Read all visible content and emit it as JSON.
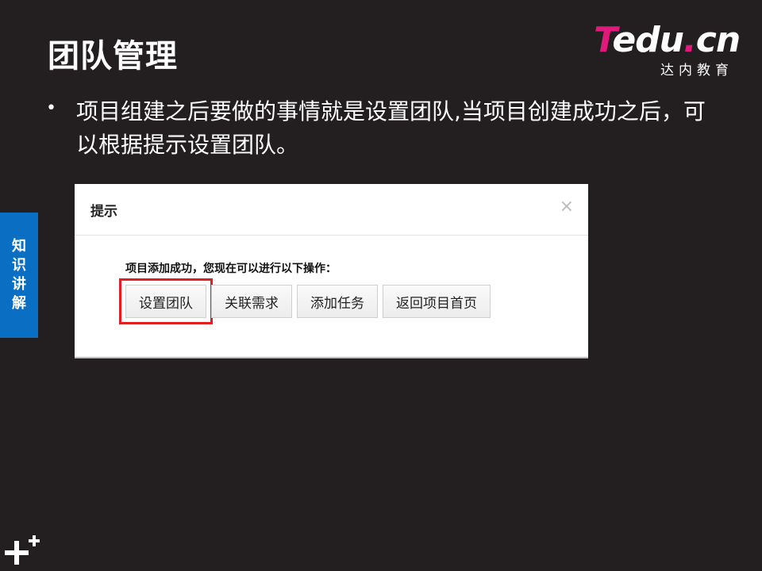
{
  "slide": {
    "title": "团队管理",
    "bullet": "项目组建之后要做的事情就是设置团队,当项目创建成功之后，可以根据提示设置团队。",
    "side_tab": [
      "知",
      "识",
      "讲",
      "解"
    ]
  },
  "logo": {
    "t": "T",
    "edu": "edu",
    "dot": ".",
    "cn": "cn",
    "subtitle": "达内教育",
    "colors": {
      "accent": "#e0197c"
    }
  },
  "dialog": {
    "title": "提示",
    "close_icon": "×",
    "message": "项目添加成功，您现在可以进行以下操作：",
    "buttons": [
      {
        "label": "设置团队",
        "highlighted": true
      },
      {
        "label": "关联需求",
        "highlighted": false
      },
      {
        "label": "添加任务",
        "highlighted": false
      },
      {
        "label": "返回项目首页",
        "highlighted": false
      }
    ]
  },
  "colors": {
    "background": "#231f20",
    "side_tab": "#0a6fc2",
    "highlight_border": "#e02020"
  }
}
